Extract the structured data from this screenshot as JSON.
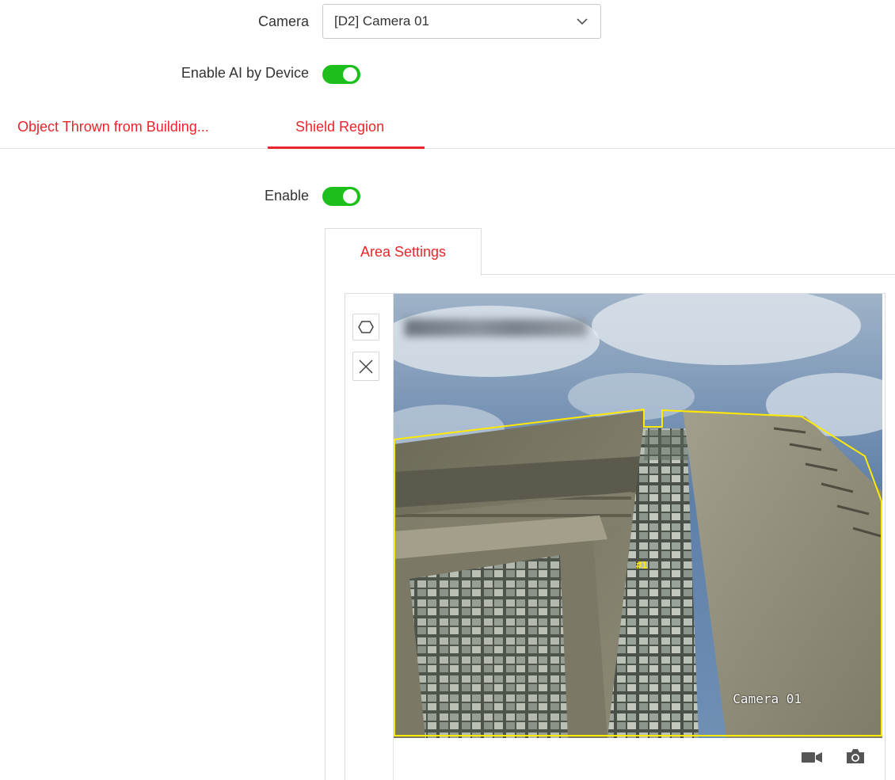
{
  "colors": {
    "accent": "#e8262b",
    "toggle_on": "#1dbf1d",
    "region_line": "#ffea00",
    "icon_gray": "#555555"
  },
  "camera": {
    "label": "Camera",
    "selected": "[D2] Camera 01",
    "dropdown_icon": "chevron-down-icon"
  },
  "enable_ai": {
    "label": "Enable AI by Device",
    "on": true
  },
  "tabs": [
    {
      "label": "Object Thrown from Building...",
      "active": false
    },
    {
      "label": "Shield Region",
      "active": true
    }
  ],
  "enable": {
    "label": "Enable",
    "on": true
  },
  "area_settings": {
    "tab_label": "Area Settings",
    "tools": [
      {
        "name": "draw-polygon",
        "icon": "hexagon-icon"
      },
      {
        "name": "clear",
        "icon": "close-icon"
      }
    ],
    "video": {
      "osd_camera": "Camera 01",
      "region_label": "#1"
    },
    "bottom_icons": [
      "video-camera-icon",
      "snapshot-camera-icon"
    ]
  }
}
